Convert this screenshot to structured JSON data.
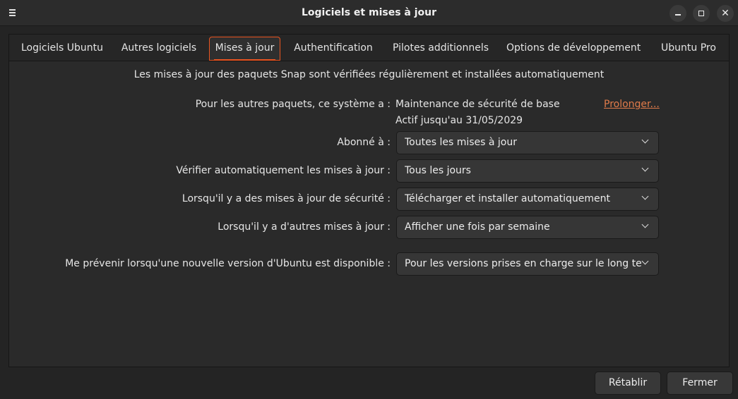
{
  "window": {
    "title": "Logiciels et mises à jour"
  },
  "tabs": [
    {
      "label": "Logiciels Ubuntu"
    },
    {
      "label": "Autres logiciels"
    },
    {
      "label": "Mises à jour"
    },
    {
      "label": "Authentification"
    },
    {
      "label": "Pilotes additionnels"
    },
    {
      "label": "Options de développement"
    },
    {
      "label": "Ubuntu Pro"
    }
  ],
  "active_tab": "Mises à jour",
  "updates": {
    "snap_notice": "Les mises à jour des paquets Snap sont vérifiées régulièrement et installées automatiquement",
    "other_packages_label": "Pour les autres paquets, ce système a :",
    "maintenance_value": "Maintenance de sécurité de base",
    "active_until": "Actif jusqu'au 31/05/2029",
    "extend_link": "Prolonger...",
    "subscribed_label": "Abonné à :",
    "subscribed_value": "Toutes les mises à jour",
    "auto_check_label": "Vérifier automatiquement les mises à jour :",
    "auto_check_value": "Tous les jours",
    "security_label": "Lorsqu'il y a des mises à jour de sécurité :",
    "security_value": "Télécharger et installer automatiquement",
    "other_updates_label": "Lorsqu'il y a d'autres mises à jour :",
    "other_updates_value": "Afficher une fois par semaine",
    "notify_label": "Me prévenir lorsqu'une nouvelle version d'Ubuntu est disponible :",
    "notify_value": "Pour les versions prises en charge sur le long terme"
  },
  "buttons": {
    "reset": "Rétablir",
    "close": "Fermer"
  },
  "icons": {
    "menu": "hamburger-menu-icon",
    "minimize": "minimize-icon",
    "maximize": "maximize-icon",
    "close": "close-icon",
    "dropdown": "chevron-down-icon"
  },
  "colors": {
    "accent": "#e95420",
    "link": "#e07b4a",
    "background": "#2a2a2a"
  }
}
